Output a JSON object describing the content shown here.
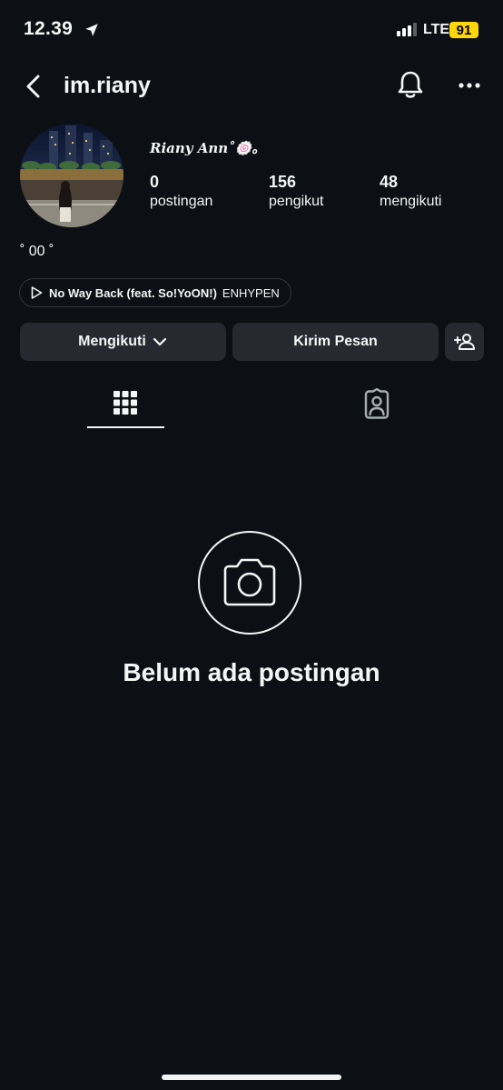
{
  "status_bar": {
    "time": "12.39",
    "network": "LTE",
    "battery": "91",
    "location_icon": "location-arrow-icon"
  },
  "header": {
    "username": "im.riany",
    "back_icon": "chevron-left-icon",
    "bell_icon": "bell-icon",
    "more_icon": "more-horizontal-icon"
  },
  "profile": {
    "display_name": "Riany Ann˚🍥。",
    "stats": [
      {
        "value": "0",
        "label": "postingan"
      },
      {
        "value": "156",
        "label": "pengikut"
      },
      {
        "value": "48",
        "label": "mengikuti"
      }
    ],
    "bio": "˚ 00 ˚",
    "music": {
      "title": "No Way Back (feat. So!YoON!)",
      "artist": "ENHYPEN"
    }
  },
  "actions": {
    "following_label": "Mengikuti",
    "message_label": "Kirim Pesan"
  },
  "tabs": {
    "posts_icon": "grid-icon",
    "tagged_icon": "tagged-person-icon"
  },
  "empty_state": {
    "text": "Belum ada postingan",
    "icon": "camera-icon"
  },
  "colors": {
    "background": "#0c1014",
    "button": "#262a30",
    "battery": "#ffd60a",
    "text": "#f5f5f5"
  }
}
